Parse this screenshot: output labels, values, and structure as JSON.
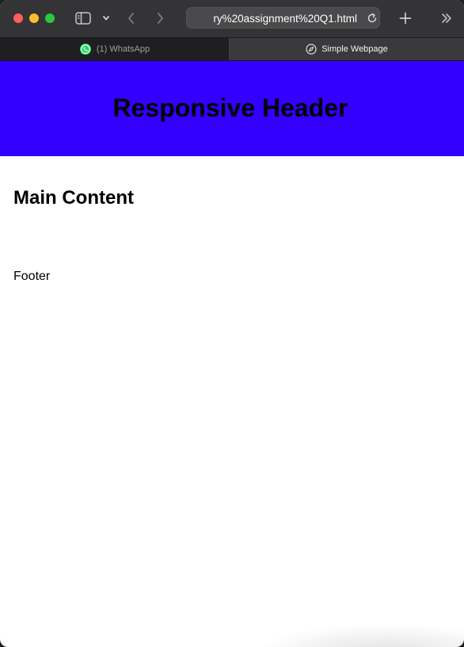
{
  "browser": {
    "address_text": "ry%20assignment%20Q1.html",
    "tabs": [
      {
        "label": "(1) WhatsApp",
        "icon": "whatsapp-icon",
        "active": false
      },
      {
        "label": "Simple Webpage",
        "icon": "compass-icon",
        "active": true
      }
    ]
  },
  "page": {
    "header_title": "Responsive Header",
    "main_heading": "Main Content",
    "footer_text": "Footer"
  },
  "colors": {
    "header_bg": "#3300ff",
    "titlebar_bg": "#343436",
    "whatsapp_green": "#25d366"
  }
}
